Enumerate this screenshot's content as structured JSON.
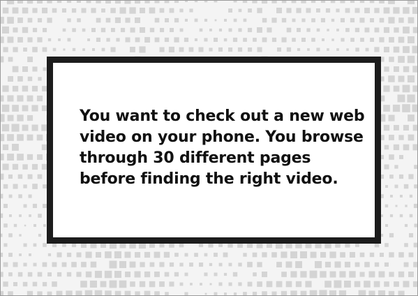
{
  "slide": {
    "message_lines": [
      "You want to check out a new web",
      "video on your phone. You browse",
      "through 30 different pages",
      "before finding the right video."
    ]
  },
  "colors": {
    "background": "#f4f4f4",
    "pattern_square": "#d4d4d4",
    "card_border": "#1c1c1c",
    "card_fill": "#ffffff",
    "text": "#111111"
  }
}
